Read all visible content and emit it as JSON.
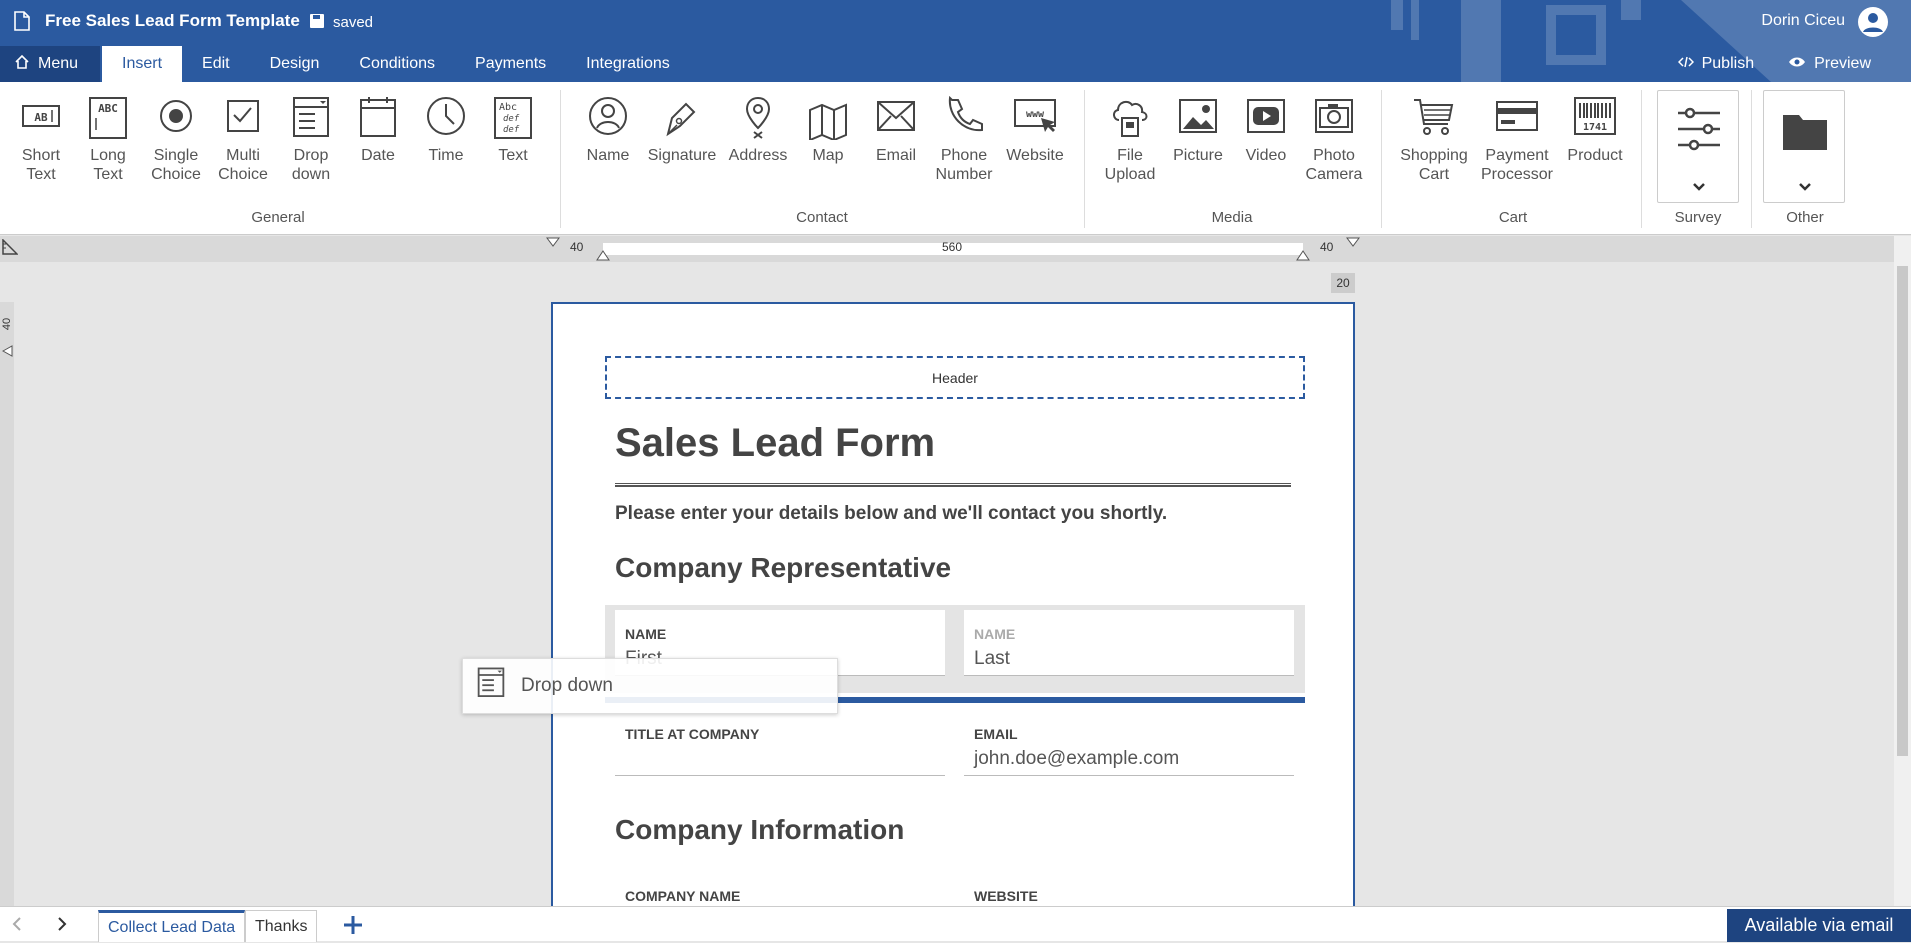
{
  "app": {
    "title": "Free Sales Lead Form Template",
    "save_status": "saved",
    "user_name": "Dorin Ciceu"
  },
  "menu": {
    "label": "Menu"
  },
  "tabs": [
    {
      "label": "Insert",
      "active": true
    },
    {
      "label": "Edit"
    },
    {
      "label": "Design"
    },
    {
      "label": "Conditions"
    },
    {
      "label": "Payments"
    },
    {
      "label": "Integrations"
    }
  ],
  "top_actions": {
    "publish": "Publish",
    "preview": "Preview"
  },
  "ribbon": {
    "general": {
      "label": "General",
      "tools": [
        {
          "l1": "Short",
          "l2": "Text",
          "icon": "short-text-icon"
        },
        {
          "l1": "Long",
          "l2": "Text",
          "icon": "long-text-icon"
        },
        {
          "l1": "Single",
          "l2": "Choice",
          "icon": "single-choice-icon"
        },
        {
          "l1": "Multi",
          "l2": "Choice",
          "icon": "multi-choice-icon"
        },
        {
          "l1": "Drop",
          "l2": "down",
          "icon": "dropdown-icon"
        },
        {
          "l1": "Date",
          "l2": "",
          "icon": "calendar-icon"
        },
        {
          "l1": "Time",
          "l2": "",
          "icon": "clock-icon"
        },
        {
          "l1": "Text",
          "l2": "",
          "icon": "text-block-icon"
        }
      ]
    },
    "contact": {
      "label": "Contact",
      "tools": [
        {
          "l1": "Name",
          "l2": "",
          "icon": "person-icon"
        },
        {
          "l1": "Signature",
          "l2": "",
          "icon": "pen-icon"
        },
        {
          "l1": "Address",
          "l2": "",
          "icon": "location-pin-icon"
        },
        {
          "l1": "Map",
          "l2": "",
          "icon": "map-icon"
        },
        {
          "l1": "Email",
          "l2": "",
          "icon": "envelope-icon"
        },
        {
          "l1": "Phone",
          "l2": "Number",
          "icon": "phone-icon"
        },
        {
          "l1": "Website",
          "l2": "",
          "icon": "www-icon"
        }
      ]
    },
    "media": {
      "label": "Media",
      "tools": [
        {
          "l1": "File",
          "l2": "Upload",
          "icon": "cloud-upload-icon"
        },
        {
          "l1": "Picture",
          "l2": "",
          "icon": "picture-icon"
        },
        {
          "l1": "Video",
          "l2": "",
          "icon": "video-icon"
        },
        {
          "l1": "Photo",
          "l2": "Camera",
          "icon": "camera-icon"
        }
      ]
    },
    "cart": {
      "label": "Cart",
      "tools": [
        {
          "l1": "Shopping",
          "l2": "Cart",
          "icon": "cart-icon"
        },
        {
          "l1": "Payment",
          "l2": "Processor",
          "icon": "credit-card-icon"
        },
        {
          "l1": "Product",
          "l2": "",
          "icon": "barcode-icon"
        }
      ],
      "barcode_text": "1741"
    },
    "survey": {
      "label": "Survey",
      "icon": "sliders-icon"
    },
    "other": {
      "label": "Other",
      "icon": "folder-icon"
    }
  },
  "ruler": {
    "left_margin": "40",
    "width": "560",
    "right_margin": "40",
    "vertical_margin": "40",
    "spacing_badge": "20"
  },
  "form": {
    "header_placeholder": "Header",
    "title": "Sales Lead Form",
    "subtitle": "Please enter your details below and we'll contact you shortly.",
    "section1": "Company Representative",
    "name_first": {
      "label": "NAME",
      "value": "First"
    },
    "name_last": {
      "label": "NAME",
      "value": "Last"
    },
    "title_at_company": {
      "label": "TITLE AT COMPANY",
      "value": ""
    },
    "email": {
      "label": "EMAIL",
      "value": "john.doe@example.com"
    },
    "section2": "Company Information",
    "company_name": {
      "label": "COMPANY NAME"
    },
    "website": {
      "label": "WEBSITE"
    }
  },
  "drag_ghost": {
    "label": "Drop down",
    "icon": "dropdown-icon"
  },
  "bottom": {
    "pages": [
      {
        "label": "Collect Lead Data",
        "active": true
      },
      {
        "label": "Thanks"
      }
    ],
    "add_icon": "plus-icon",
    "availability": "Available via email"
  },
  "colors": {
    "brand": "#2b5aa0",
    "brand_dark": "#1e4480"
  }
}
